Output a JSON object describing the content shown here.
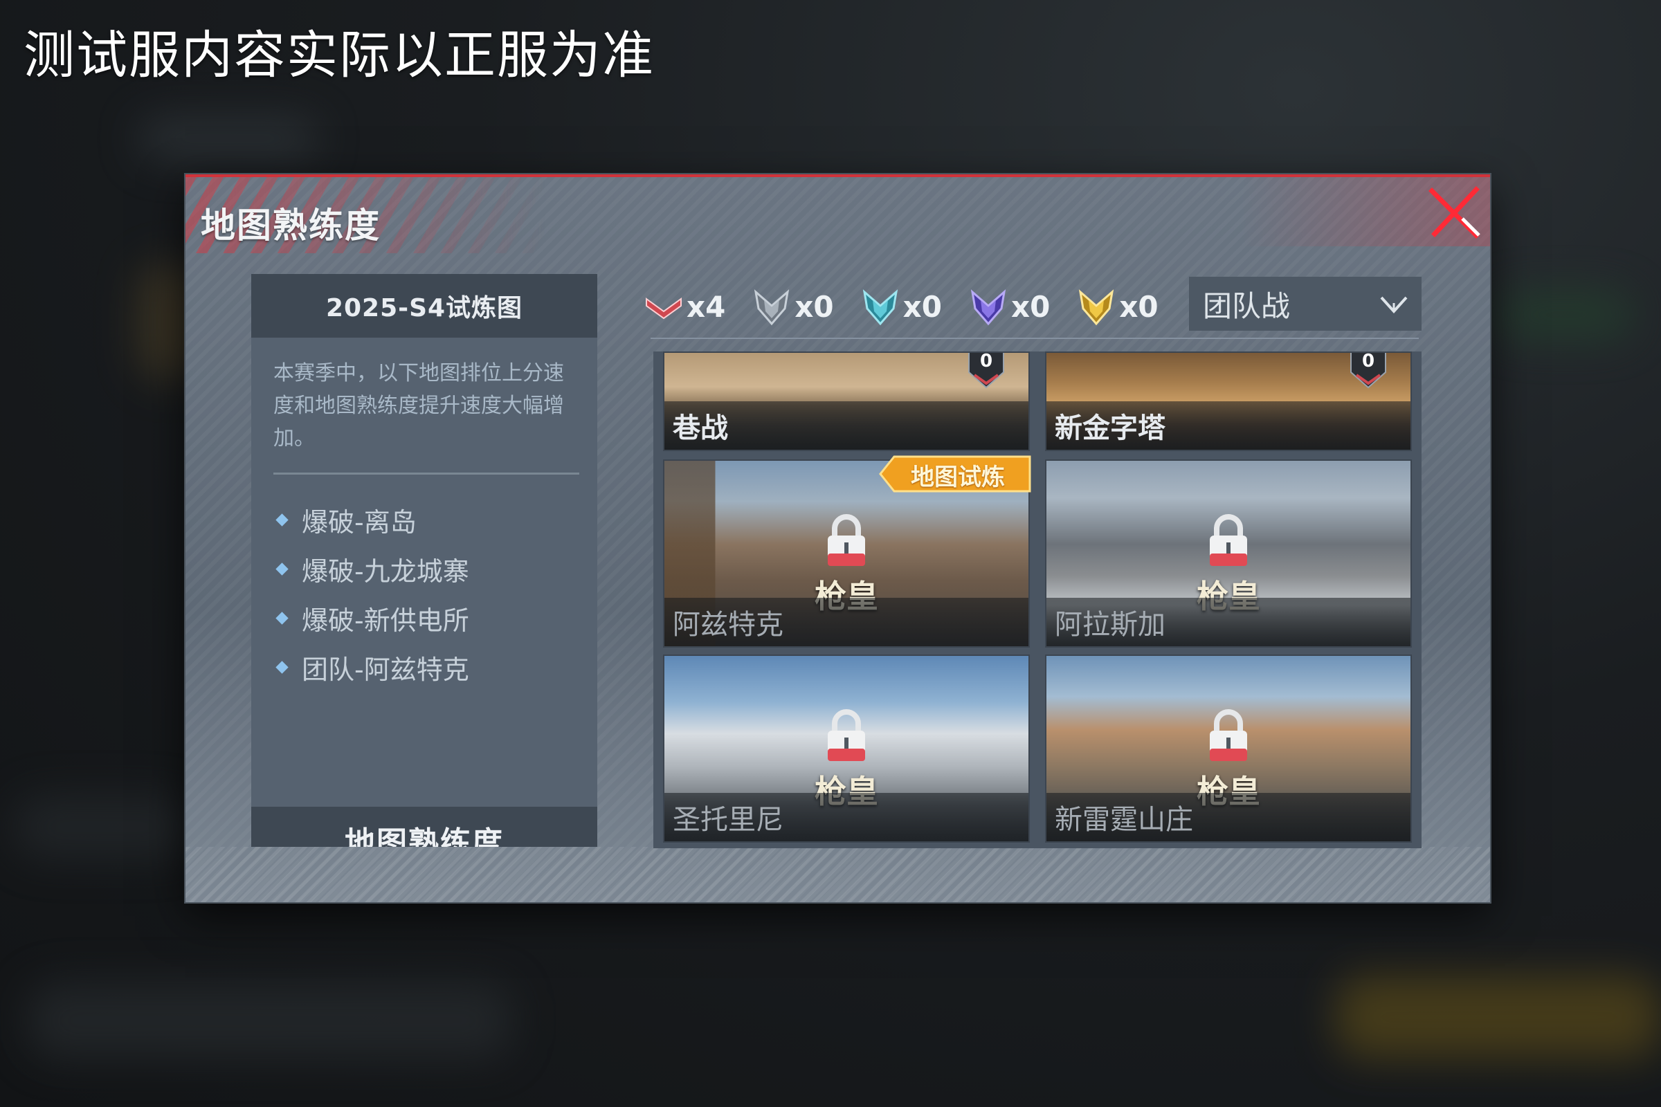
{
  "notice": "测试服内容实际以正服为准",
  "modal": {
    "title": "地图熟练度",
    "close_icon": "close-icon"
  },
  "left_panel": {
    "header": "2025-S4试炼图",
    "description": "本赛季中，以下地图排位上分速度和地图熟练度提升速度大幅增加。",
    "items": [
      {
        "label": "爆破-离岛"
      },
      {
        "label": "爆破-九龙城寨"
      },
      {
        "label": "爆破-新供电所"
      },
      {
        "label": "团队-阿兹特克"
      }
    ],
    "footer": "地图熟练度"
  },
  "badges": [
    {
      "icon": "chevron-rank-red-icon",
      "color": "#d04850",
      "count": "x4"
    },
    {
      "icon": "rank-silver-icon",
      "color": "#9aa3ad",
      "count": "x0"
    },
    {
      "icon": "rank-teal-icon",
      "color": "#4fb8c8",
      "count": "x0"
    },
    {
      "icon": "rank-purple-icon",
      "color": "#7a64d8",
      "count": "x0"
    },
    {
      "icon": "rank-gold-icon",
      "color": "#e5b73a",
      "count": "x0"
    }
  ],
  "mode_select": {
    "value": "团队战",
    "icon": "chevron-down-icon"
  },
  "maps": [
    {
      "name": "巷战",
      "locked": false,
      "rank_badge": "0"
    },
    {
      "name": "新金字塔",
      "locked": false,
      "rank_badge": "0"
    },
    {
      "name": "阿兹特克",
      "locked": true,
      "rank": "枪皇",
      "tag": "地图试炼"
    },
    {
      "name": "阿拉斯加",
      "locked": true,
      "rank": "枪皇"
    },
    {
      "name": "圣托里尼",
      "locked": true,
      "rank": "枪皇"
    },
    {
      "name": "新雷霆山庄",
      "locked": true,
      "rank": "枪皇"
    }
  ],
  "colors": {
    "accent_red": "#d1323a",
    "tag_orange": "#f0a020",
    "panel": "#566270",
    "header": "#3e4853"
  }
}
